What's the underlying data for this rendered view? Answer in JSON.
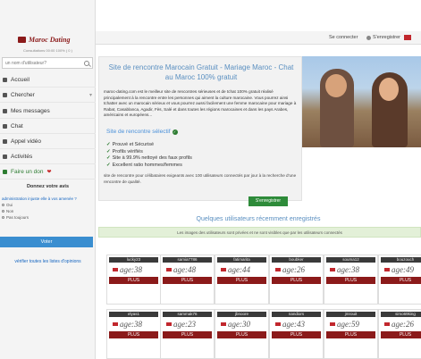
{
  "sidebar": {
    "logo_text": "Maroc Dating",
    "stats_line": "Consultations 00:00 100% ( 0 )",
    "search_placeholder": "un nom d'utilisateur?",
    "nav": [
      {
        "label": "Accueil"
      },
      {
        "label": "Chercher"
      },
      {
        "label": "Mes messages"
      },
      {
        "label": "Chat"
      },
      {
        "label": "Appel vidéo"
      },
      {
        "label": "Activités"
      },
      {
        "label": "Faire un don"
      }
    ],
    "poll": {
      "title": "Donnez votre avis",
      "question": "administration injuste elle à vos amenée ?",
      "options": [
        "Oui",
        "Non",
        "Pas toujours"
      ],
      "vote_label": "Voter",
      "link_label": "vérifier toutes les listes d'opinions"
    }
  },
  "header": {
    "connect_label": "Se connecter",
    "register_label": "S'enregistrer"
  },
  "hero": {
    "title": "Site de rencontre Marocain Gratuit - Mariage Maroc - Chat au Maroc 100% gratuit",
    "text": "maroc-dating.com est le meilleur site de rencontres sérieuses et de tchat 100% gratuit réalisé principalement à la rencontre entre les personnes qui aiment la culture marocaine. Vous pourrez ainsi tchatter avec un marocain sérieux et vous pourrez aussi facilement une femme marocaine pour mariage à Rabat, Casablanca, Agadir, Fès, Salé et dans toutes les régions marocaines et dans les pays Arabes, américains et européens...",
    "subtitle": "Site de rencontre sélectif",
    "features": [
      "Prouvé et Sécurisé",
      "Profils vérifiés",
      "Site à 99.9% nettoyé des faux profils",
      "Excellent ratio hommes/femmes"
    ],
    "footer_text": "site de rencontre pour célibataires exigeants avec 100 utilisateurs connectés par jour à la recherche d'une rencontre de qualité.",
    "cta_label": "S'enregistrer"
  },
  "recent": {
    "title": "Quelques utilisateurs récemment enregistrés",
    "privacy_note": "Les images des utilisateurs sont privées et ne sont visibles que par les utilisateurs connectés",
    "plus_label": "PLUS",
    "profiles": [
      {
        "name": "lucky23",
        "age_label": "age:38"
      },
      {
        "name": "samia7786",
        "age_label": "age:48"
      },
      {
        "name": "fatimarita",
        "age_label": "age:44"
      },
      {
        "name": "boubker",
        "age_label": "age:26"
      },
      {
        "name": "souma12",
        "age_label": "age:38"
      },
      {
        "name": "bouzouch",
        "age_label": "age:49"
      },
      {
        "name": "elyas1",
        "age_label": "age:38"
      },
      {
        "name": "sammak76",
        "age_label": "age:23"
      },
      {
        "name": "jbnoore",
        "age_label": "age:30"
      },
      {
        "name": "nandiors",
        "age_label": "age:43"
      },
      {
        "name": "jmrouit",
        "age_label": "age:59"
      },
      {
        "name": "simo69king",
        "age_label": "age:26"
      }
    ]
  }
}
